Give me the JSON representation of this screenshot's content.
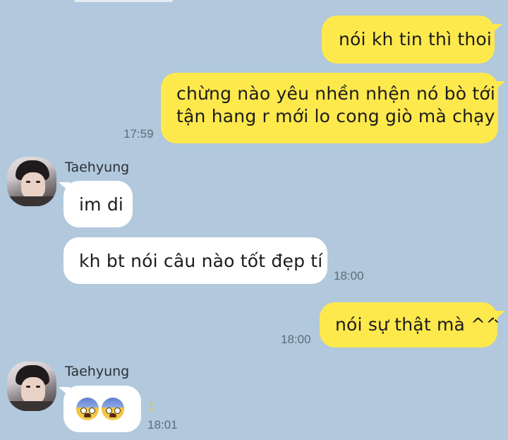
{
  "messages": {
    "m1": {
      "text": "nói kh tin thì thoi"
    },
    "m2": {
      "line1": "chừng nào yêu nhền nhện nó bò tới",
      "line2": "tận hang r mới lo cong giò mà chạy",
      "time": "17:59"
    },
    "m3": {
      "sender": "Taehyung",
      "text": "im di"
    },
    "m4": {
      "text": "kh bt nói câu nào tốt đẹp tí",
      "time": "18:00"
    },
    "m5": {
      "text": "nói sự thật mà ^^",
      "time": "18:00"
    },
    "m6": {
      "sender": "Taehyung",
      "unread": "1",
      "time": "18:01",
      "emojis": [
        "anxious-face-emoji",
        "anxious-face-emoji"
      ]
    }
  },
  "colors": {
    "background": "#b2c8dc",
    "my_bubble": "#fee94d",
    "their_bubble": "#ffffff",
    "unread_count": "#e8c820"
  }
}
